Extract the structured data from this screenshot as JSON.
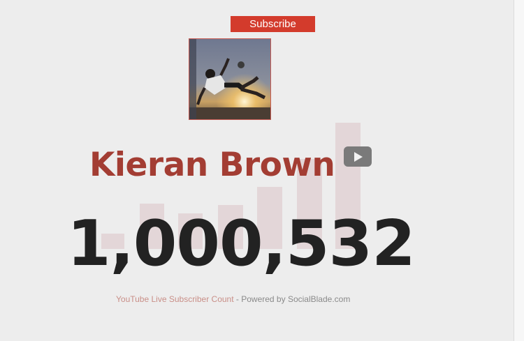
{
  "subscribe_button": {
    "label": "Subscribe"
  },
  "channel": {
    "name": "Kieran Brown",
    "subscriber_count": "1,000,532",
    "avatar_icon": "channel-avatar-photo",
    "youtube_icon": "youtube-play-icon"
  },
  "footer": {
    "link_text": "YouTube Live Subscriber Count",
    "separator": " - ",
    "powered_by": "Powered by SocialBlade.com"
  },
  "colors": {
    "subscribe_bg": "#d33b2c",
    "name_color": "#a33d33",
    "count_color": "#222222",
    "background": "#ededed",
    "decor_bars": "#e3d6d8"
  }
}
